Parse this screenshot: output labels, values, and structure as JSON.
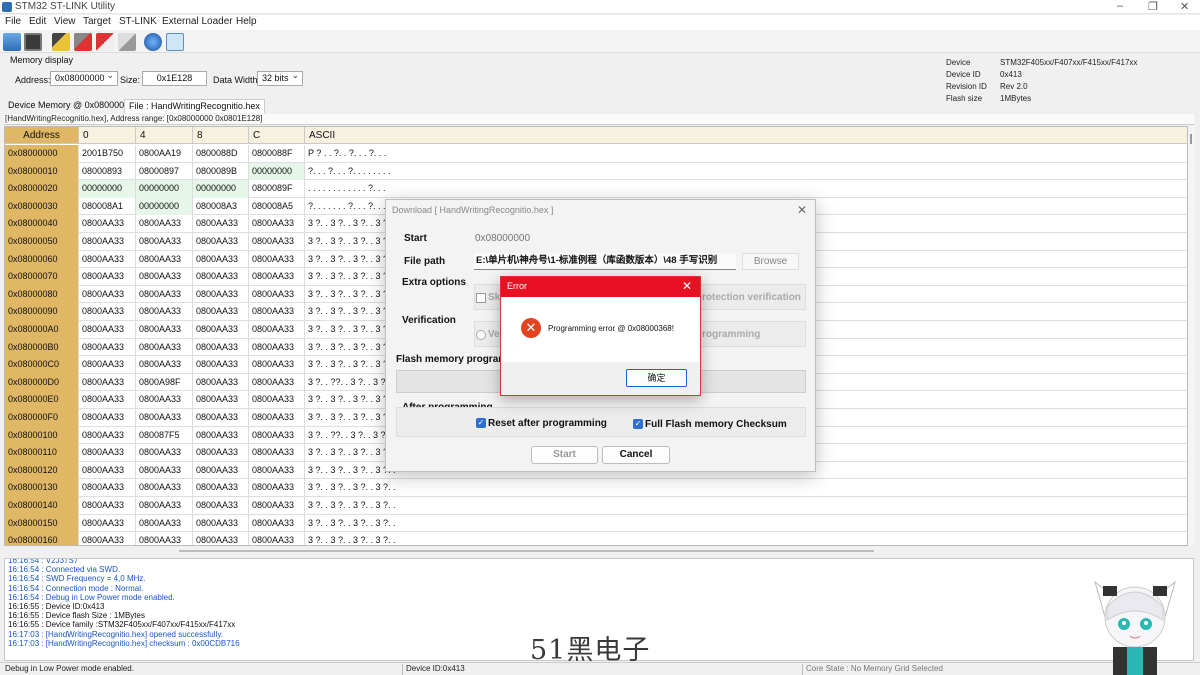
{
  "window": {
    "title": "STM32 ST-LINK Utility"
  },
  "menu": [
    "File",
    "Edit",
    "View",
    "Target",
    "ST-LINK",
    "External Loader",
    "Help"
  ],
  "toolbar_icons": [
    "open-file-icon",
    "save-icon",
    "connect-icon",
    "disconnect-icon",
    "erase-icon",
    "program-icon",
    "verify-icon",
    "swv-icon"
  ],
  "memory_display": {
    "heading": "Memory display",
    "address_label": "Address:",
    "address_value": "0x08000000",
    "size_label": "Size:",
    "size_value": "0x1E128",
    "data_width_label": "Data Width:",
    "data_width_value": "32 bits"
  },
  "device_info": {
    "device_label": "Device",
    "device_value": "STM32F405xx/F407xx/F415xx/F417xx",
    "device_id_label": "Device ID",
    "device_id_value": "0x413",
    "revision_label": "Revision ID",
    "revision_value": "Rev 2.0",
    "flash_label": "Flash size",
    "flash_value": "1MBytes"
  },
  "tabs": {
    "device_memory": "Device Memory @ 0x08000000 :",
    "file": "File : HandWritingRecognitio.hex"
  },
  "address_bar": "[HandWritingRecognitio.hex], Address range: [0x08000000 0x0801E128]",
  "grid": {
    "headers": [
      "Address",
      "0",
      "4",
      "8",
      "C",
      "ASCII"
    ],
    "rows": [
      [
        "0x08000000",
        "2001B750",
        "0800AA19",
        "0800088D",
        "0800088F",
        "P ? .  . ?. . ?. . . ?. . ."
      ],
      [
        "0x08000010",
        "08000893",
        "08000897",
        "0800089B",
        "00000000",
        "?. . . ?. . . ?. . . . . . . ."
      ],
      [
        "0x08000020",
        "00000000",
        "00000000",
        "00000000",
        "0800089F",
        ". . . . . . . . . . . . ?. . ."
      ],
      [
        "0x08000030",
        "080008A1",
        "00000000",
        "080008A3",
        "080008A5",
        "?. . . . . . . ?. . . ?. . ."
      ],
      [
        "0x08000040",
        "0800AA33",
        "0800AA33",
        "0800AA33",
        "0800AA33",
        "3 ?. . 3 ?. . 3 ?. . 3 ?. ."
      ],
      [
        "0x08000050",
        "0800AA33",
        "0800AA33",
        "0800AA33",
        "0800AA33",
        "3 ?. . 3 ?. . 3 ?. . 3 ?. ."
      ],
      [
        "0x08000060",
        "0800AA33",
        "0800AA33",
        "0800AA33",
        "0800AA33",
        "3 ?. . 3 ?. . 3 ?. . 3 ?. ."
      ],
      [
        "0x08000070",
        "0800AA33",
        "0800AA33",
        "0800AA33",
        "0800AA33",
        "3 ?. . 3 ?. . 3 ?. . 3 ?. ."
      ],
      [
        "0x08000080",
        "0800AA33",
        "0800AA33",
        "0800AA33",
        "0800AA33",
        "3 ?. . 3 ?. . 3 ?. . 3 ?. ."
      ],
      [
        "0x08000090",
        "0800AA33",
        "0800AA33",
        "0800AA33",
        "0800AA33",
        "3 ?. . 3 ?. . 3 ?. . 3 ?. ."
      ],
      [
        "0x080000A0",
        "0800AA33",
        "0800AA33",
        "0800AA33",
        "0800AA33",
        "3 ?. . 3 ?. . 3 ?. . 3 ?. ."
      ],
      [
        "0x080000B0",
        "0800AA33",
        "0800AA33",
        "0800AA33",
        "0800AA33",
        "3 ?. . 3 ?. . 3 ?. . 3 ?. ."
      ],
      [
        "0x080000C0",
        "0800AA33",
        "0800AA33",
        "0800AA33",
        "0800AA33",
        "3 ?. . 3 ?. . 3 ?. . 3 ?. ."
      ],
      [
        "0x080000D0",
        "0800AA33",
        "0800A98F",
        "0800AA33",
        "0800AA33",
        "3 ?. . ??. . 3 ?. . 3 ?. ."
      ],
      [
        "0x080000E0",
        "0800AA33",
        "0800AA33",
        "0800AA33",
        "0800AA33",
        "3 ?. . 3 ?. . 3 ?. . 3 ?. ."
      ],
      [
        "0x080000F0",
        "0800AA33",
        "0800AA33",
        "0800AA33",
        "0800AA33",
        "3 ?. . 3 ?. . 3 ?. . 3 ?. ."
      ],
      [
        "0x08000100",
        "0800AA33",
        "080087F5",
        "0800AA33",
        "0800AA33",
        "3 ?. . ??. . 3 ?. . 3 ?. ."
      ],
      [
        "0x08000110",
        "0800AA33",
        "0800AA33",
        "0800AA33",
        "0800AA33",
        "3 ?. . 3 ?. . 3 ?. . 3 ?. ."
      ],
      [
        "0x08000120",
        "0800AA33",
        "0800AA33",
        "0800AA33",
        "0800AA33",
        "3 ?. . 3 ?. . 3 ?. . 3 ?. ."
      ],
      [
        "0x08000130",
        "0800AA33",
        "0800AA33",
        "0800AA33",
        "0800AA33",
        "3 ?. . 3 ?. . 3 ?. . 3 ?. ."
      ],
      [
        "0x08000140",
        "0800AA33",
        "0800AA33",
        "0800AA33",
        "0800AA33",
        "3 ?. . 3 ?. . 3 ?. . 3 ?. ."
      ],
      [
        "0x08000150",
        "0800AA33",
        "0800AA33",
        "0800AA33",
        "0800AA33",
        "3 ?. . 3 ?. . 3 ?. . 3 ?. ."
      ],
      [
        "0x08000160",
        "0800AA33",
        "0800AA33",
        "0800AA33",
        "0800AA33",
        "3 ?. . 3 ?. . 3 ?. . 3 ?. ."
      ]
    ]
  },
  "log": [
    {
      "text": "16:16:54 : V2J37S7",
      "color": "#1a55c8"
    },
    {
      "text": "16:16:54 : Connected via SWD.",
      "color": "#1a55c8"
    },
    {
      "text": "16:16:54 : SWD Frequency = 4,0 MHz.",
      "color": "#1a55c8"
    },
    {
      "text": "16:16:54 : Connection mode : Normal.",
      "color": "#1a55c8"
    },
    {
      "text": "16:16:54 : Debug in Low Power mode enabled.",
      "color": "#1a55c8"
    },
    {
      "text": "16:16:55 : Device ID:0x413",
      "color": "#111111"
    },
    {
      "text": "16:16:55 : Device flash Size : 1MBytes",
      "color": "#111111"
    },
    {
      "text": "16:16:55 : Device family :STM32F405xx/F407xx/F415xx/F417xx",
      "color": "#111111"
    },
    {
      "text": "16:17:03 : [HandWritingRecognitio.hex] opened successfully.",
      "color": "#1a55c8"
    },
    {
      "text": "16:17:03 : [HandWritingRecognitio.hex] checksum : 0x00CDB716",
      "color": "#1a55c8"
    }
  ],
  "status": {
    "left": "Debug in Low Power mode enabled.",
    "middle": "Device ID:0x413",
    "right": "Core State : No Memory Grid Selected"
  },
  "watermark": "51黑电子",
  "download_dialog": {
    "title": "Download [ HandWritingRecognitio.hex ]",
    "start_label": "Start",
    "start_value": "0x08000000",
    "file_path_label": "File path",
    "file_path_value": "E:\\单片机\\神舟号\\1-标准例程（库函数版本）\\48 手写识别",
    "browse_label": "Browse",
    "extra_options_label": "Extra options",
    "extra_skip_partial": "Sk",
    "extra_protection_partial": "rotection verification",
    "verification_label": "Verification",
    "verify_partial": "Ve",
    "programming_partial": "rogramming",
    "flash_progress_label": "Flash memory program",
    "after_programming_label": "After programming",
    "reset_after_label": "Reset after programming",
    "checksum_label": "Full Flash memory Checksum",
    "start_button": "Start",
    "cancel_button": "Cancel"
  },
  "error_dialog": {
    "title": "Error",
    "message": "Programming error @ 0x08000368!",
    "ok_label": "确定"
  },
  "colors": {
    "address_column": "#e0b865",
    "header_row": "#f7f1df",
    "zero_cell": "#e6f6e8",
    "error_header": "#e81123",
    "error_icon": "#e2441f",
    "checkbox": "#2f6fd0"
  }
}
